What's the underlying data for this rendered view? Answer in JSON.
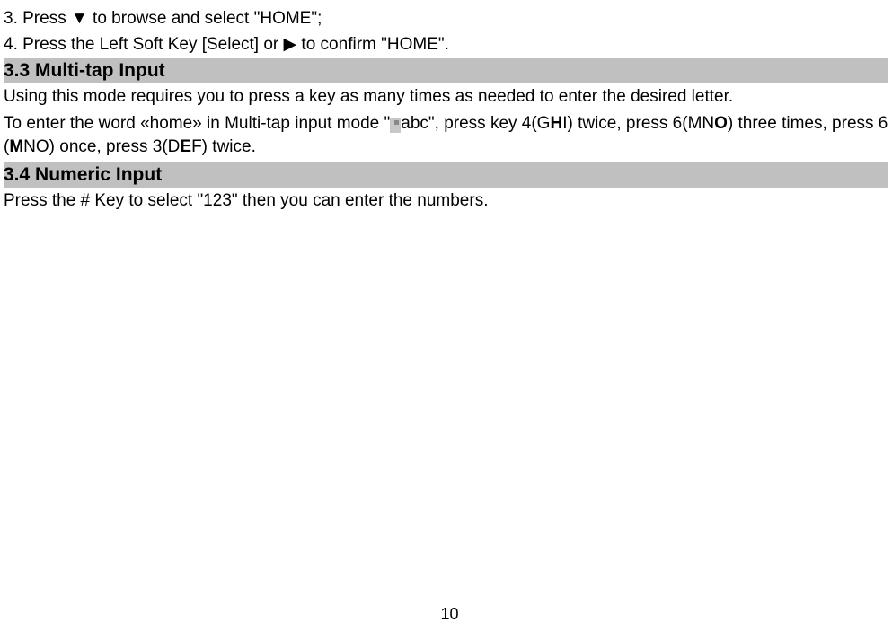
{
  "steps": {
    "step3": "3. Press ▼ to browse and select \"HOME\";",
    "step4": "4. Press the Left Soft Key [Select] or  ▶  to confirm \"HOME\"."
  },
  "section33": {
    "heading": "3.3 Multi-tap Input",
    "para1": "Using this mode requires you to press a key as many times as needed to enter the desired letter.",
    "para2_part1": "To enter the word «home» in Multi-tap input mode \"",
    "para2_part2_a": "abc\", press key 4(G",
    "para2_part2_b": "H",
    "para2_part2_c": "I) twice, press 6(MN",
    "para2_part2_d": "O",
    "para2_part2_e": ") three times, press 6 (",
    "para2_part2_f": "M",
    "para2_part2_g": "NO) once, press 3(D",
    "para2_part2_h": "E",
    "para2_part2_i": "F) twice."
  },
  "section34": {
    "heading": "3.4 Numeric Input",
    "para1": "Press the # Key to select \"123\" then you can enter the numbers."
  },
  "pageNumber": "10"
}
